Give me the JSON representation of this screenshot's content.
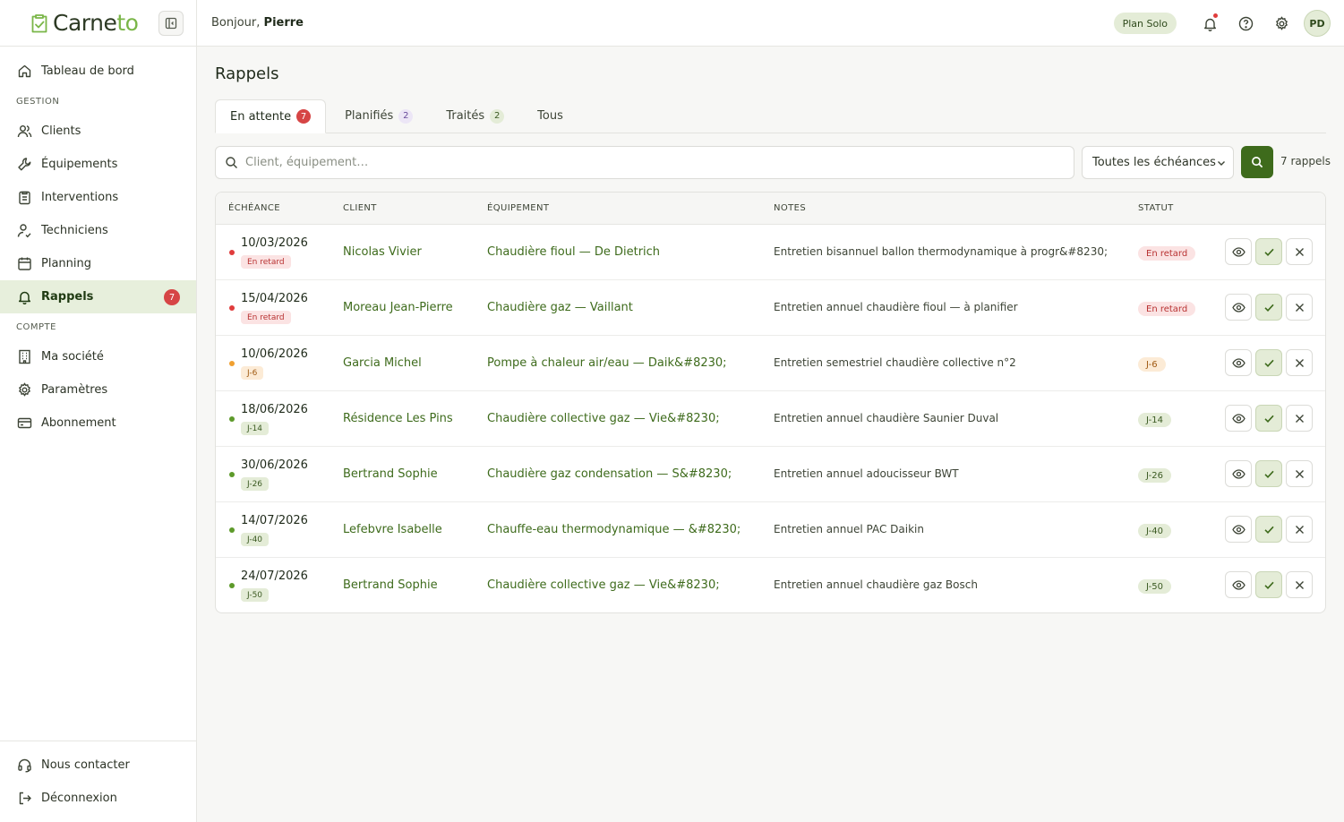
{
  "brand": {
    "name_part1": "Carne",
    "name_part2": "to"
  },
  "header": {
    "greeting_prefix": "Bonjour,",
    "user_first_name": "Pierre",
    "plan": "Plan Solo",
    "avatar_initials": "PD"
  },
  "sidebar": {
    "dashboard": "Tableau de bord",
    "section_gestion": "GESTION",
    "gestion_items": [
      {
        "label": "Clients",
        "icon": "users-icon"
      },
      {
        "label": "Équipements",
        "icon": "wrench-icon"
      },
      {
        "label": "Interventions",
        "icon": "clipboard-icon"
      },
      {
        "label": "Techniciens",
        "icon": "technician-icon"
      },
      {
        "label": "Planning",
        "icon": "calendar-icon"
      },
      {
        "label": "Rappels",
        "icon": "bell-icon",
        "badge": "7"
      }
    ],
    "section_compte": "COMPTE",
    "compte_items": [
      {
        "label": "Ma société",
        "icon": "building-icon"
      },
      {
        "label": "Paramètres",
        "icon": "gear-icon"
      },
      {
        "label": "Abonnement",
        "icon": "card-icon"
      }
    ],
    "bottom_items": [
      {
        "label": "Nous contacter",
        "icon": "headset-icon"
      },
      {
        "label": "Déconnexion",
        "icon": "logout-icon"
      }
    ]
  },
  "page": {
    "title": "Rappels"
  },
  "tabs": [
    {
      "label": "En attente",
      "count": "7"
    },
    {
      "label": "Planifiés",
      "count": "2"
    },
    {
      "label": "Traités",
      "count": "2"
    },
    {
      "label": "Tous",
      "count": ""
    }
  ],
  "filters": {
    "search_placeholder": "Client, équipement…",
    "deadline_select": "Toutes les échéances",
    "result_count": "7 rappels"
  },
  "table": {
    "headers": {
      "deadline": "ÉCHÉANCE",
      "client": "CLIENT",
      "equipment": "ÉQUIPEMENT",
      "notes": "NOTES",
      "status": "STATUT"
    },
    "rows": [
      {
        "date": "10/03/2026",
        "due": "En retard",
        "client": "Nicolas Vivier",
        "equipment": "Chaudière fioul — De Dietrich",
        "notes": "Entretien bisannuel ballon thermodynamique à progr&#8230;",
        "status": "En retard",
        "level": "red"
      },
      {
        "date": "15/04/2026",
        "due": "En retard",
        "client": "Moreau Jean-Pierre",
        "equipment": "Chaudière gaz — Vaillant",
        "notes": "Entretien annuel chaudière fioul — à planifier",
        "status": "En retard",
        "level": "red"
      },
      {
        "date": "10/06/2026",
        "due": "J-6",
        "client": "Garcia Michel",
        "equipment": "Pompe à chaleur air/eau — Daik&#8230;",
        "notes": "Entretien semestriel chaudière collective n°2",
        "status": "J-6",
        "level": "orange"
      },
      {
        "date": "18/06/2026",
        "due": "J-14",
        "client": "Résidence Les Pins",
        "equipment": "Chaudière collective gaz — Vie&#8230;",
        "notes": "Entretien annuel chaudière Saunier Duval",
        "status": "J-14",
        "level": "green"
      },
      {
        "date": "30/06/2026",
        "due": "J-26",
        "client": "Bertrand Sophie",
        "equipment": "Chaudière gaz condensation — S&#8230;",
        "notes": "Entretien annuel adoucisseur BWT",
        "status": "J-26",
        "level": "green"
      },
      {
        "date": "14/07/2026",
        "due": "J-40",
        "client": "Lefebvre Isabelle",
        "equipment": "Chauffe-eau thermodynamique — &#8230;",
        "notes": "Entretien annuel PAC Daikin",
        "status": "J-40",
        "level": "green"
      },
      {
        "date": "24/07/2026",
        "due": "J-50",
        "client": "Bertrand Sophie",
        "equipment": "Chaudière collective gaz — Vie&#8230;",
        "notes": "Entretien annuel chaudière gaz Bosch",
        "status": "J-50",
        "level": "green"
      }
    ]
  },
  "colors": {
    "accent": "#3e6b1c",
    "red": "#e03c3c",
    "orange": "#f0a030",
    "green": "#5d9a2a"
  }
}
